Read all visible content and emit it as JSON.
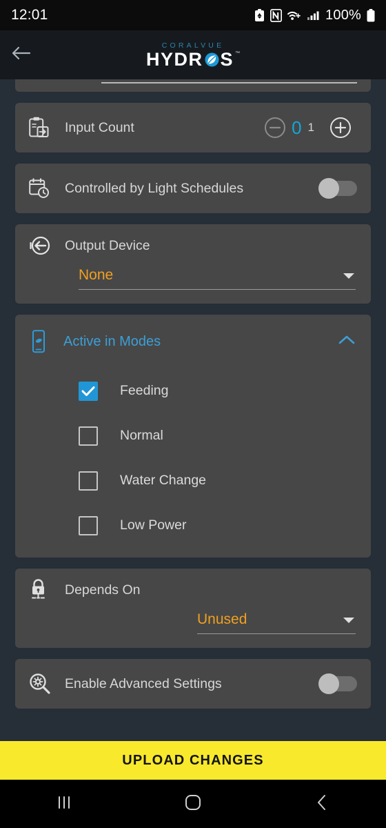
{
  "statusbar": {
    "time": "12:01",
    "battery_percent": "100%",
    "icons": [
      "battery-saver-icon",
      "nfc-icon",
      "wifi-icon",
      "cellular-signal-icon",
      "battery-icon"
    ]
  },
  "appbar": {
    "back_icon": "back-arrow-icon",
    "brand_top": "CORALVUE",
    "brand_main_left": "HYDR",
    "brand_main_right": "S",
    "trademark": "™"
  },
  "rows": {
    "input_count": {
      "label": "Input Count",
      "icon": "clipboard-input-icon",
      "decrement": "−",
      "increment": "+",
      "value": "0",
      "max": "1"
    },
    "light_schedules": {
      "label": "Controlled by Light Schedules",
      "icon": "calendar-clock-icon",
      "toggle_state": "off"
    },
    "output_device": {
      "label": "Output Device",
      "icon": "output-arrow-icon",
      "value": "None"
    },
    "active_in_modes": {
      "label": "Active in Modes",
      "icon": "device-wave-icon",
      "expanded": "true",
      "chevron": "chevron-up-icon",
      "modes": [
        {
          "label": "Feeding",
          "checked": true
        },
        {
          "label": "Normal",
          "checked": false
        },
        {
          "label": "Water Change",
          "checked": false
        },
        {
          "label": "Low Power",
          "checked": false
        }
      ]
    },
    "depends_on": {
      "label": "Depends On",
      "icon": "lock-dependency-icon",
      "value": "Unused"
    },
    "advanced_settings": {
      "label": "Enable Advanced Settings",
      "icon": "magnifier-gear-icon",
      "toggle_state": "off"
    }
  },
  "upload_button": {
    "label": "UPLOAD CHANGES"
  },
  "navbar": {
    "recents": "recents-icon",
    "home": "home-icon",
    "back": "back-icon"
  },
  "colors": {
    "accent_blue": "#11a7d9",
    "accent_orange": "#f0a020",
    "upload_yellow": "#f8e92c",
    "card_bg": "#474747",
    "page_bg": "#262e38"
  }
}
